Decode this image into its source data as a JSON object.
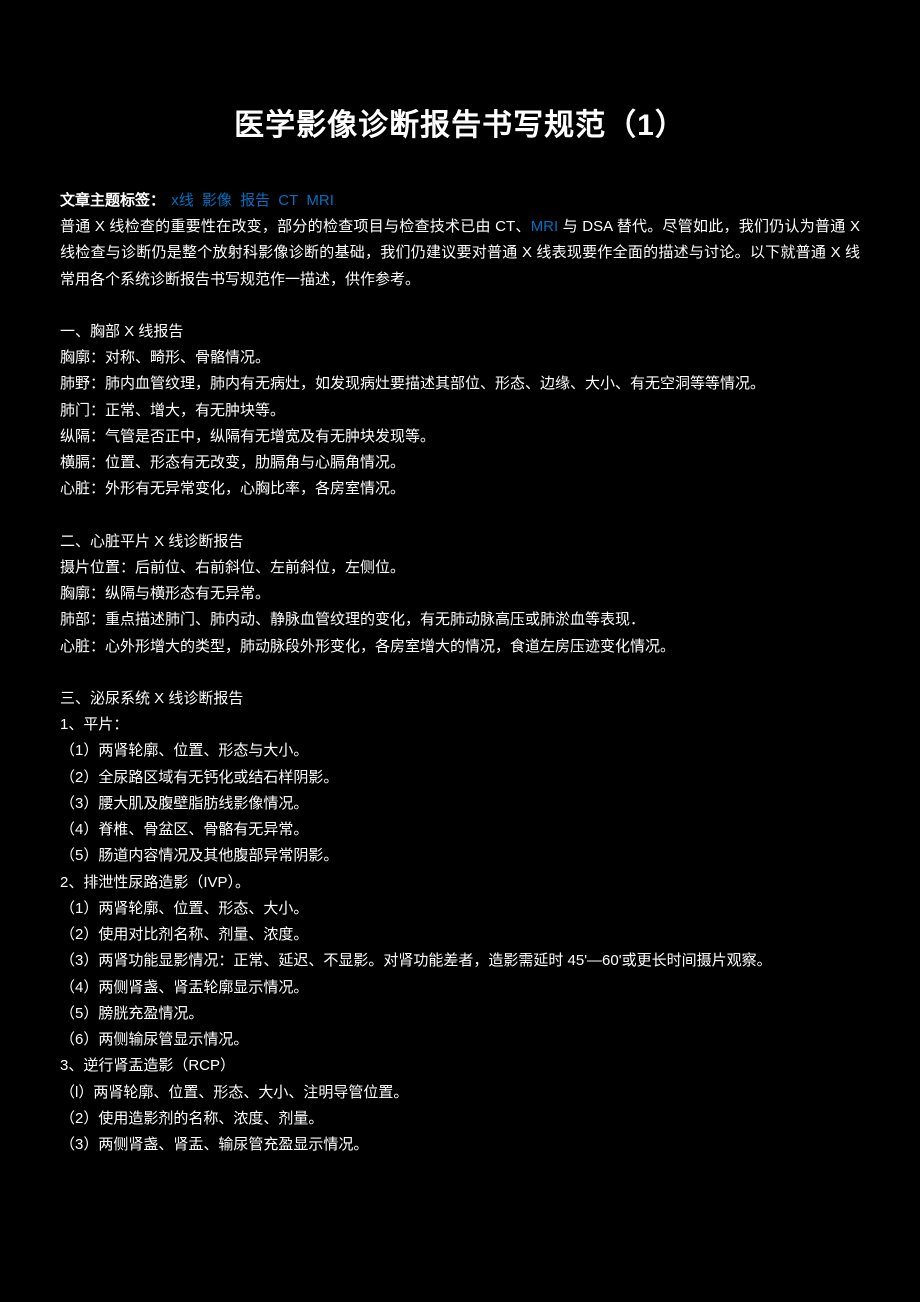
{
  "title": "医学影像诊断报告书写规范（1）",
  "tags": {
    "label": "文章主题标签：",
    "items": [
      "x线",
      "影像",
      "报告",
      "CT",
      "MRI"
    ]
  },
  "intro": {
    "seg1": "普通 X 线检查的重要性在改变，部分的检查项目与检查技术已由 CT、",
    "link1": "MRI",
    "seg2": " 与 DSA 替代。尽管如此，我们仍认为普通 X 线检查与诊断仍是整个放射科影像诊断的基础，我们仍建议要对普通 X 线表现要作全面的描述与讨论。以下就普通 X 线常用各个系统诊断报告书写规范作一描述，供作参考。"
  },
  "sections": [
    {
      "heading": "一、胸部 X 线报告",
      "lines": [
        "胸廓：对称、畸形、骨骼情况。",
        "肺野：肺内血管纹理，肺内有无病灶，如发现病灶要描述其部位、形态、边缘、大小、有无空洞等等情况。",
        "肺门：正常、增大，有无肿块等。",
        "纵隔：气管是否正中，纵隔有无增宽及有无肿块发现等。",
        "横膈：位置、形态有无改变，肋膈角与心膈角情况。",
        "心脏：外形有无异常变化，心胸比率，各房室情况。"
      ]
    },
    {
      "heading": "二、心脏平片 X 线诊断报告",
      "lines": [
        "摄片位置：后前位、右前斜位、左前斜位，左侧位。",
        "胸廓：纵隔与横形态有无异常。",
        "肺部：重点描述肺门、肺内动、静脉血管纹理的变化，有无肺动脉高压或肺淤血等表现．",
        "心脏：心外形增大的类型，肺动脉段外形变化，各房室增大的情况，食道左房压迹变化情况。"
      ]
    },
    {
      "heading": "三、泌尿系统 X 线诊断报告",
      "lines": [
        "1、平片：",
        "（1）两肾轮廓、位置、形态与大小。",
        "（2）全尿路区域有无钙化或结石样阴影。",
        "（3）腰大肌及腹壁脂肪线影像情况。",
        "（4）脊椎、骨盆区、骨骼有无异常。",
        "（5）肠道内容情况及其他腹部异常阴影。",
        "2、排泄性尿路造影（IVP）。",
        "（1）两肾轮廓、位置、形态、大小。",
        "（2）使用对比剂名称、剂量、浓度。",
        "（3）两肾功能显影情况：正常、延迟、不显影。对肾功能差者，造影需延时 45'—60'或更长时间摄片观察。",
        "（4）两侧肾盏、肾盂轮廓显示情况。",
        "（5）膀胱充盈情况。",
        "（6）两侧输尿管显示情况。",
        "3、逆行肾盂造影（RCP）",
        "（l）两肾轮廓、位置、形态、大小、注明导管位置。",
        "（2）使用造影剂的名称、浓度、剂量。",
        "（3）两侧肾盏、肾盂、输尿管充盈显示情况。"
      ]
    }
  ]
}
